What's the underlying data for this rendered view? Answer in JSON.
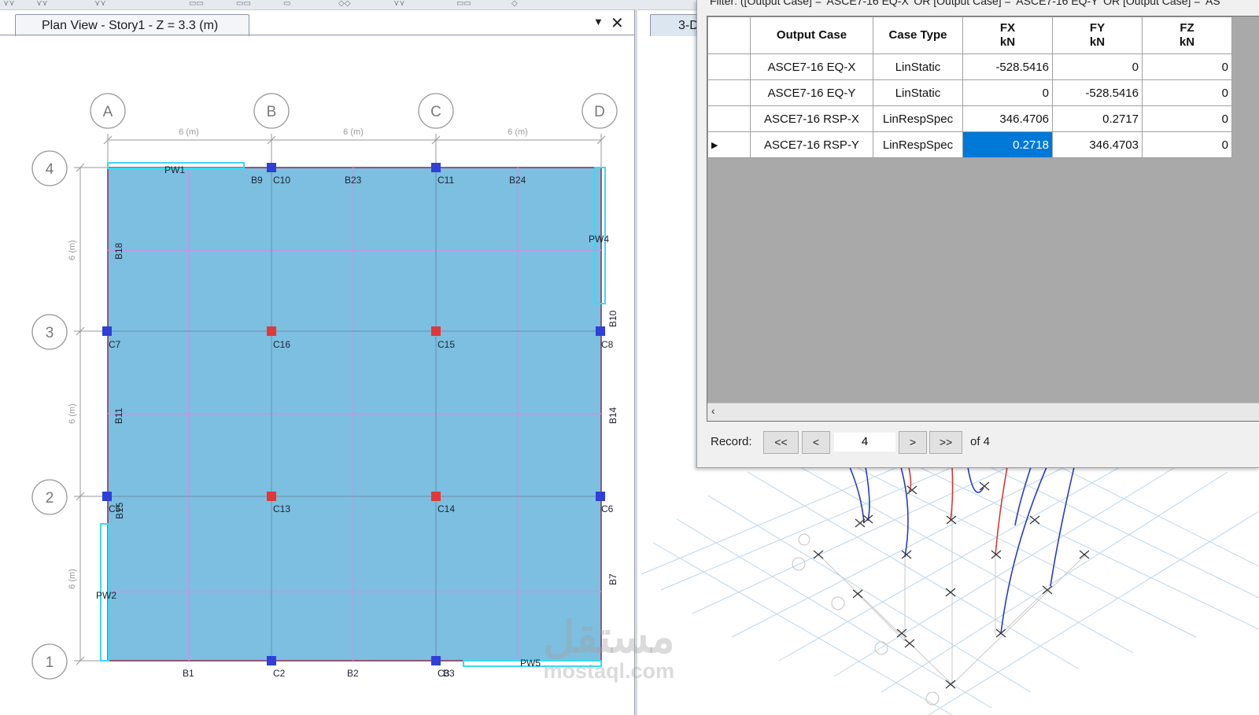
{
  "plan_view": {
    "tab_title": "Plan View - Story1 - Z = 3.3 (m)",
    "x_grid_labels": [
      "A",
      "B",
      "C",
      "D"
    ],
    "y_grid_labels": [
      "4",
      "3",
      "2",
      "1"
    ],
    "x_dimensions": [
      "6 (m)",
      "6 (m)",
      "6 (m)"
    ],
    "y_dimensions": [
      "6 (m)",
      "6 (m)",
      "6 (m)"
    ],
    "element_labels": {
      "pw1": "PW1",
      "pw2": "PW2",
      "pw4": "PW4",
      "pw5": "PW5",
      "b9": "B9",
      "c10": "C10",
      "b23": "B23",
      "c11": "C11",
      "b24": "B24",
      "b18": "B18",
      "b10": "B10",
      "c7": "C7",
      "c16": "C16",
      "c15": "C15",
      "c8": "C8",
      "b11": "B11",
      "b14": "B14",
      "c5": "C5",
      "b15": "B15",
      "c13": "C13",
      "c14": "C14",
      "c6": "C6",
      "b7": "B7",
      "b1": "B1",
      "c2": "C2",
      "b2": "B2",
      "c3": "C3",
      "b3": "B3"
    },
    "colors": {
      "slab": "#7cbfe0",
      "edge_column": "#2f3fd8",
      "interior_column": "#e03838",
      "beam_line": "#cf8fe8",
      "wall": "#3ed8f0"
    }
  },
  "view3d": {
    "tab_title": "3-D"
  },
  "dialog": {
    "filter_text": "Filter:  ([Output Case] = 'ASCE7-16 EQ-X' OR [Output Case] = 'ASCE7-16 EQ-Y' OR [Output Case] = 'AS",
    "columns": [
      {
        "title": "Output Case",
        "unit": ""
      },
      {
        "title": "Case Type",
        "unit": ""
      },
      {
        "title": "FX",
        "unit": "kN"
      },
      {
        "title": "FY",
        "unit": "kN"
      },
      {
        "title": "FZ",
        "unit": "kN"
      }
    ],
    "rows": [
      {
        "case": "ASCE7-16 EQ-X",
        "type": "LinStatic",
        "fx": "-528.5416",
        "fy": "0",
        "fz": "0"
      },
      {
        "case": "ASCE7-16 EQ-Y",
        "type": "LinStatic",
        "fx": "0",
        "fy": "-528.5416",
        "fz": "0"
      },
      {
        "case": "ASCE7-16 RSP-X",
        "type": "LinRespSpec",
        "fx": "346.4706",
        "fy": "0.2717",
        "fz": "0"
      },
      {
        "case": "ASCE7-16 RSP-Y",
        "type": "LinRespSpec",
        "fx": "0.2718",
        "fy": "346.4703",
        "fz": "0"
      }
    ],
    "selected_row": 4,
    "selection_color": "#0078d7",
    "record": {
      "label": "Record:",
      "first": "<<",
      "prev": "<",
      "current": "4",
      "next": ">",
      "last": ">>",
      "total": "of 4"
    }
  },
  "watermark": {
    "arabic": "مستقل",
    "latin": "mostaql.com"
  }
}
